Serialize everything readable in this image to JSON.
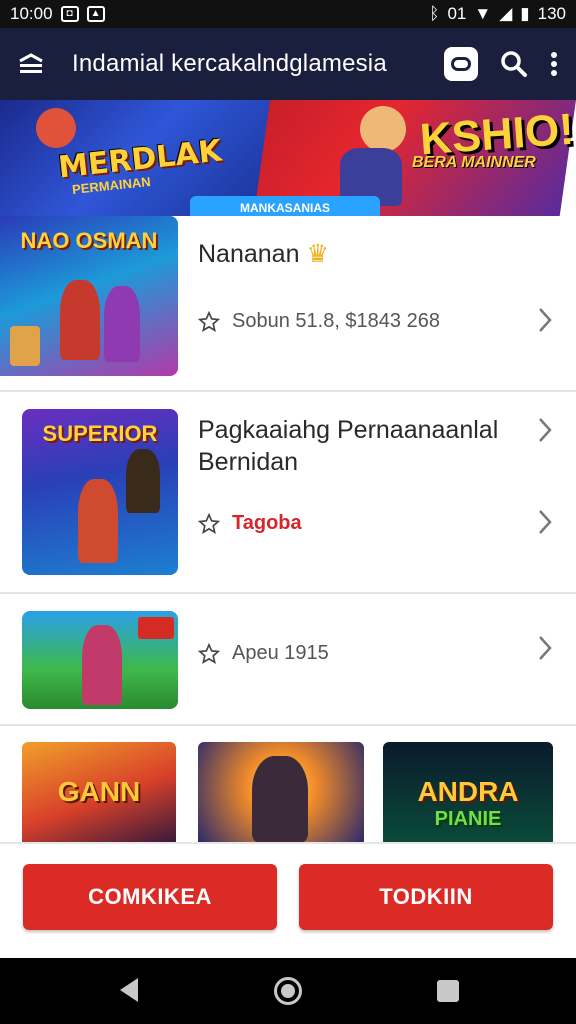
{
  "status_bar": {
    "time": "10:00",
    "battery": "130",
    "sim_label": "01"
  },
  "app_bar": {
    "title": "Indamial kercakalndglamesia"
  },
  "banner": {
    "left_title": "MERDLAK",
    "left_subtitle": "PERMAINAN",
    "right_title": "KSHIO!",
    "right_subtitle": "BERA MAINNER",
    "tab_label": "MANKASANIAS"
  },
  "rows": [
    {
      "title": "Nananan",
      "meta": "Sobun 51.8, $1843 268",
      "thumb_caption": "NAO OSMAN"
    },
    {
      "title": "Pagkaaiahg Pernaanaanlal Bernidan",
      "meta": "Tagoba",
      "thumb_caption": "SUPERIOR"
    },
    {
      "title": "",
      "meta": "Apeu 1915",
      "thumb_caption": ""
    }
  ],
  "tiles": [
    {
      "caption": "GANN"
    },
    {
      "caption": ""
    },
    {
      "caption": "ANDRA",
      "caption2": "PIANIE"
    }
  ],
  "buttons": {
    "left": "COMKIKEA",
    "right": "TODKIIN"
  },
  "colors": {
    "app_bar": "#1a1f3d",
    "accent_red": "#dc2a24"
  }
}
